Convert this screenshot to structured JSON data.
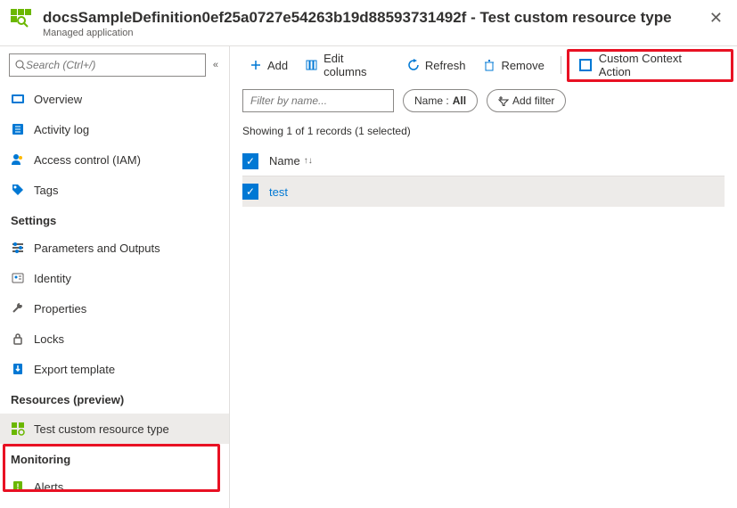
{
  "header": {
    "title": "docsSampleDefinition0ef25a0727e54263b19d88593731492f - Test custom resource type",
    "subtitle": "Managed application"
  },
  "search": {
    "placeholder": "Search (Ctrl+/)"
  },
  "nav": {
    "overview": "Overview",
    "activity_log": "Activity log",
    "access_control": "Access control (IAM)",
    "tags": "Tags",
    "group_settings": "Settings",
    "params_outputs": "Parameters and Outputs",
    "identity": "Identity",
    "properties": "Properties",
    "locks": "Locks",
    "export_template": "Export template",
    "group_resources": "Resources (preview)",
    "test_custom": "Test custom resource type",
    "group_monitoring": "Monitoring",
    "alerts": "Alerts"
  },
  "toolbar": {
    "add": "Add",
    "edit_columns": "Edit columns",
    "refresh": "Refresh",
    "remove": "Remove",
    "custom_action": "Custom Context Action"
  },
  "filters": {
    "placeholder": "Filter by name...",
    "name_label": "Name :",
    "name_value": "All",
    "add_filter": "Add filter"
  },
  "status": "Showing 1 of 1 records (1 selected)",
  "table": {
    "col_name": "Name",
    "rows": [
      {
        "name": "test"
      }
    ]
  }
}
